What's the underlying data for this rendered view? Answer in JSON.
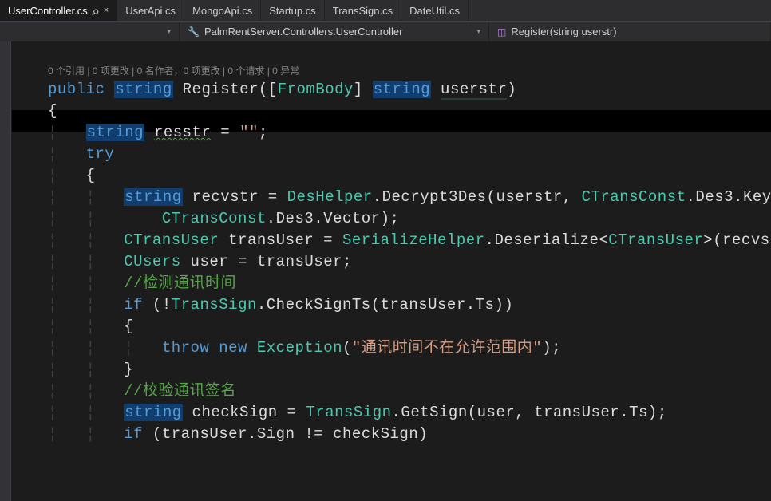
{
  "tabs": [
    {
      "label": "UserController.cs",
      "active": true,
      "pinned": true,
      "closeable": true
    },
    {
      "label": "UserApi.cs",
      "active": false
    },
    {
      "label": "MongoApi.cs",
      "active": false
    },
    {
      "label": "Startup.cs",
      "active": false
    },
    {
      "label": "TransSign.cs",
      "active": false
    },
    {
      "label": "DateUtil.cs",
      "active": false
    }
  ],
  "breadcrumb": {
    "namespace": "PalmRentServer.Controllers.UserController",
    "member": "Register(string userstr)"
  },
  "codelens": "0 个引用 | 0 项更改 | 0 名作者，0 项更改 | 0 个请求 | 0 异常",
  "code": {
    "l1": {
      "kw": "public",
      "type": "string",
      "name": "Register",
      "attr": "FromBody",
      "ptype": "string",
      "pname": "userstr"
    },
    "l2": "{",
    "l3": {
      "type": "string",
      "name": "resstr",
      "eq": "=",
      "val": "\"\"",
      "semi": ";"
    },
    "l4": "try",
    "l5": "{",
    "l6": {
      "type": "string",
      "name": "recvstr",
      "t1": "DesHelper",
      "m1": "Decrypt3Des",
      "a1": "userstr",
      "t2": "CTransConst",
      "m2": "Des3",
      "m3": "Key"
    },
    "l7": {
      "t1": "CTransConst",
      "m1": "Des3",
      "m2": "Vector"
    },
    "l8": {
      "t1": "CTransUser",
      "v": "transUser",
      "t2": "SerializeHelper",
      "m": "Deserialize",
      "gen": "CTransUser",
      "arg": "recvs"
    },
    "l9": {
      "t": "CUsers",
      "v": "user",
      "r": "transUser"
    },
    "l10": "//检测通讯时间",
    "l11": {
      "kw": "if",
      "t": "TransSign",
      "m": "CheckSignTs",
      "a": "transUser",
      "p": "Ts"
    },
    "l12": "{",
    "l13": {
      "kw1": "throw",
      "kw2": "new",
      "t": "Exception",
      "s": "\"通讯时间不在允许范围内\""
    },
    "l14": "}",
    "l15": "//校验通讯签名",
    "l16": {
      "type": "string",
      "v": "checkSign",
      "t": "TransSign",
      "m": "GetSign",
      "a1": "user",
      "a2": "transUser",
      "p": "Ts"
    },
    "l17": {
      "kw": "if",
      "a": "transUser",
      "p": "Sign",
      "op": "!=",
      "b": "checkSign"
    }
  }
}
